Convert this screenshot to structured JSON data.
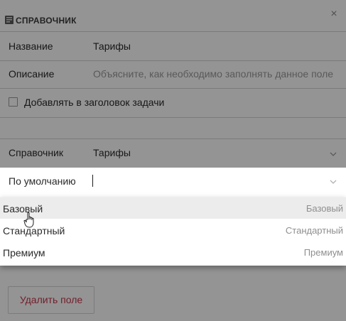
{
  "dialog": {
    "title": "СПРАВОЧНИК",
    "close_glyph": "×"
  },
  "fields": {
    "name_label": "Название",
    "name_value": "Тарифы",
    "description_label": "Описание",
    "description_placeholder": "Объясните, как необходимо заполнять данное поле",
    "add_to_title_label": "Добавлять в заголовок задачи",
    "dictionary_label": "Справочник",
    "dictionary_value": "Тарифы",
    "default_label": "По умолчанию"
  },
  "dropdown": {
    "options": [
      {
        "label": "Базовый",
        "hint": "Базовый"
      },
      {
        "label": "Стандартный",
        "hint": "Стандартный"
      },
      {
        "label": "Премиум",
        "hint": "Премиум"
      }
    ]
  },
  "actions": {
    "delete_label": "Удалить поле"
  },
  "colors": {
    "danger": "#c4364d",
    "overlay": "rgba(0,0,0,0.42)"
  },
  "icons": {
    "header": "book-icon",
    "close": "close-icon",
    "chevron": "chevron-down-icon",
    "pointer": "hand-pointer-icon"
  }
}
